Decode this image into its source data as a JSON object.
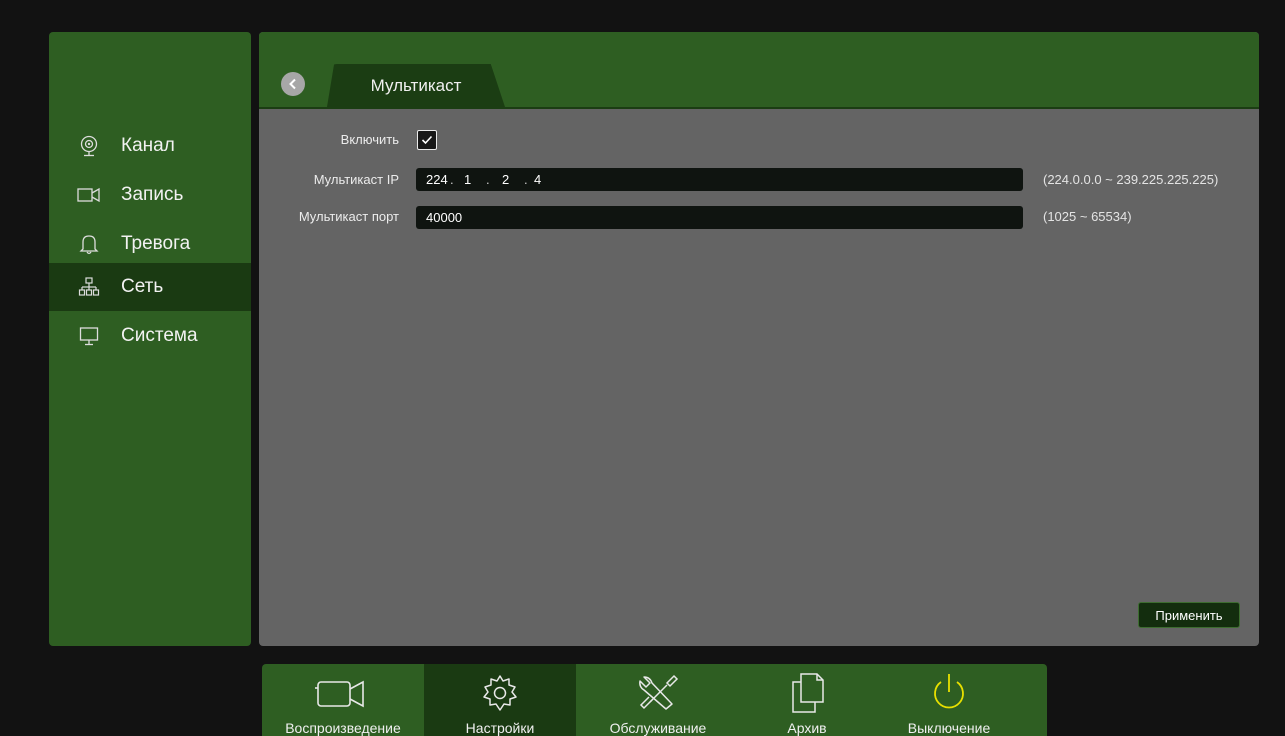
{
  "sidebar": {
    "items": [
      {
        "label": "Канал",
        "icon": "camera-icon"
      },
      {
        "label": "Запись",
        "icon": "video-camera-icon"
      },
      {
        "label": "Тревога",
        "icon": "bell-icon"
      },
      {
        "label": "Сеть",
        "icon": "network-icon",
        "active": true
      },
      {
        "label": "Система",
        "icon": "monitor-icon"
      }
    ]
  },
  "header": {
    "tab_title": "Мультикаст"
  },
  "form": {
    "enable_label": "Включить",
    "enable_checked": true,
    "ip_label": "Мультикаст IP",
    "ip": [
      "224",
      "1",
      "2",
      "4"
    ],
    "ip_range": "(224.0.0.0 ~ 239.225.225.225)",
    "port_label": "Мультикаст порт",
    "port_value": "40000",
    "port_range": "(1025 ~ 65534)",
    "apply_label": "Применить"
  },
  "bottom": {
    "items": [
      {
        "label": "Воспроизведение",
        "icon": "video-camera-icon"
      },
      {
        "label": "Настройки",
        "icon": "gear-icon",
        "active": true
      },
      {
        "label": "Обслуживание",
        "icon": "tools-icon"
      },
      {
        "label": "Архив",
        "icon": "files-icon"
      },
      {
        "label": "Выключение",
        "icon": "power-icon"
      }
    ]
  },
  "colors": {
    "accent_green": "#2e5e22",
    "dark_green": "#1a3a12",
    "power_yellow": "#e8e000"
  }
}
